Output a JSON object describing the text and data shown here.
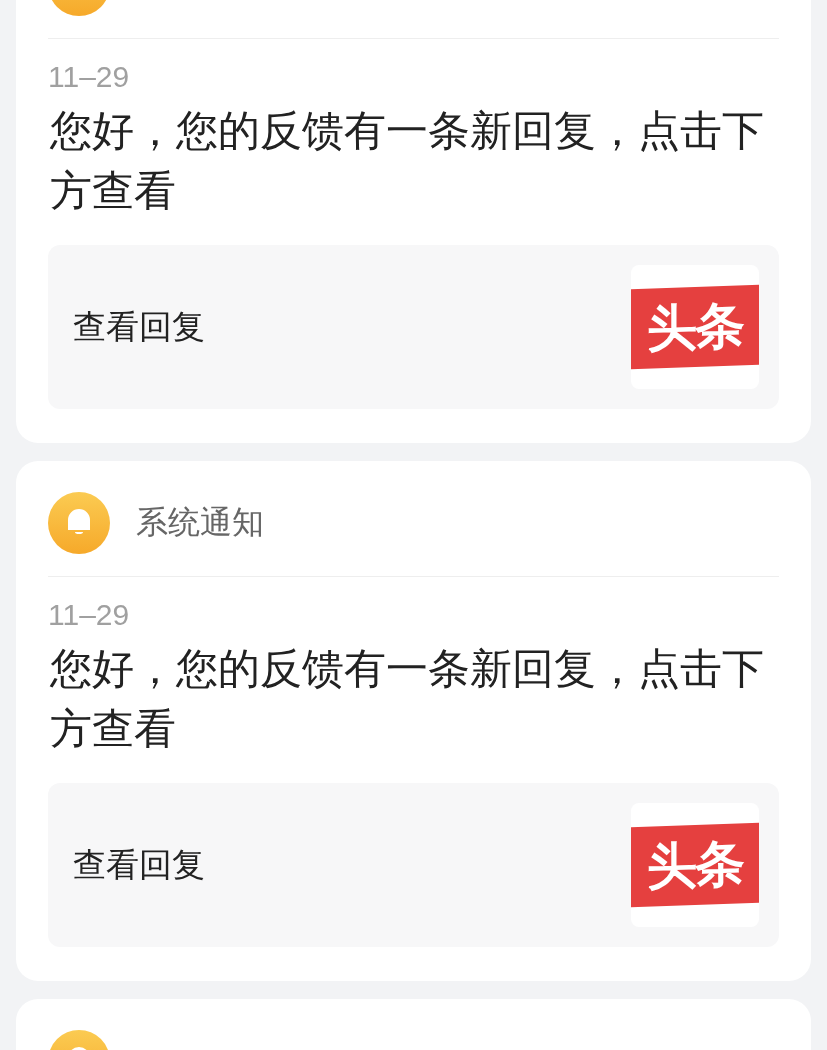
{
  "notifications": [
    {
      "kind": "full",
      "date": "11–29",
      "message": "您好，您的反馈有一条新回复，点击下方查看",
      "action": "查看回复",
      "logo": "头条"
    },
    {
      "kind": "full",
      "title": "系统通知",
      "date": "11–29",
      "message": "您好，您的反馈有一条新回复，点击下方查看",
      "action": "查看回复",
      "logo": "头条"
    },
    {
      "kind": "header_only"
    }
  ]
}
